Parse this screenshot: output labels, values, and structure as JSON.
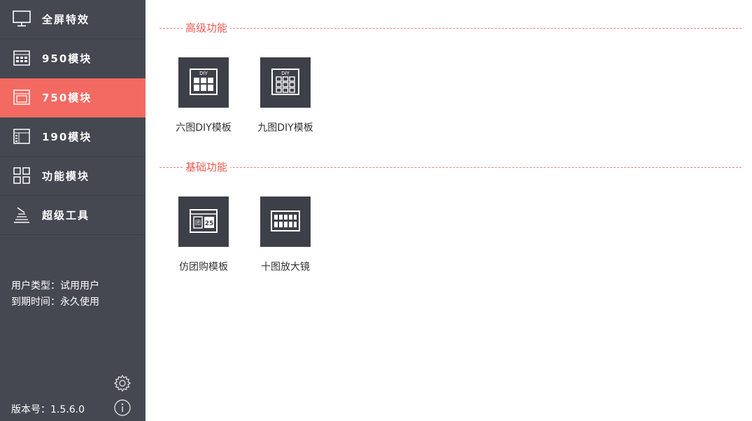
{
  "sidebar": {
    "items": [
      {
        "label": "全屏特效",
        "icon": "monitor-icon",
        "active": false
      },
      {
        "label": "950模块",
        "icon": "module-950-icon",
        "active": false
      },
      {
        "label": "750模块",
        "icon": "module-750-icon",
        "active": true
      },
      {
        "label": "190模块",
        "icon": "module-190-icon",
        "active": false
      },
      {
        "label": "功能模块",
        "icon": "grid-icon",
        "active": false
      },
      {
        "label": "超级工具",
        "icon": "tools-icon",
        "active": false
      }
    ],
    "user_type": "用户类型：试用用户",
    "expiry": "到期时间：永久使用",
    "version": "版本号：1.5.6.0"
  },
  "sections": [
    {
      "title": "高级功能",
      "tiles": [
        {
          "label": "六图DIY模板",
          "icon": "diy-six-grid-icon"
        },
        {
          "label": "九图DIY模板",
          "icon": "diy-nine-grid-icon"
        }
      ]
    },
    {
      "title": "基础功能",
      "tiles": [
        {
          "label": "仿团购模板",
          "icon": "group-buy-icon"
        },
        {
          "label": "十图放大镜",
          "icon": "ten-grid-magnifier-icon"
        }
      ]
    }
  ],
  "colors": {
    "sidebar_bg": "#454851",
    "active_bg": "#f26a62",
    "accent": "#ee5a50",
    "tile_bg": "#3e4049"
  }
}
